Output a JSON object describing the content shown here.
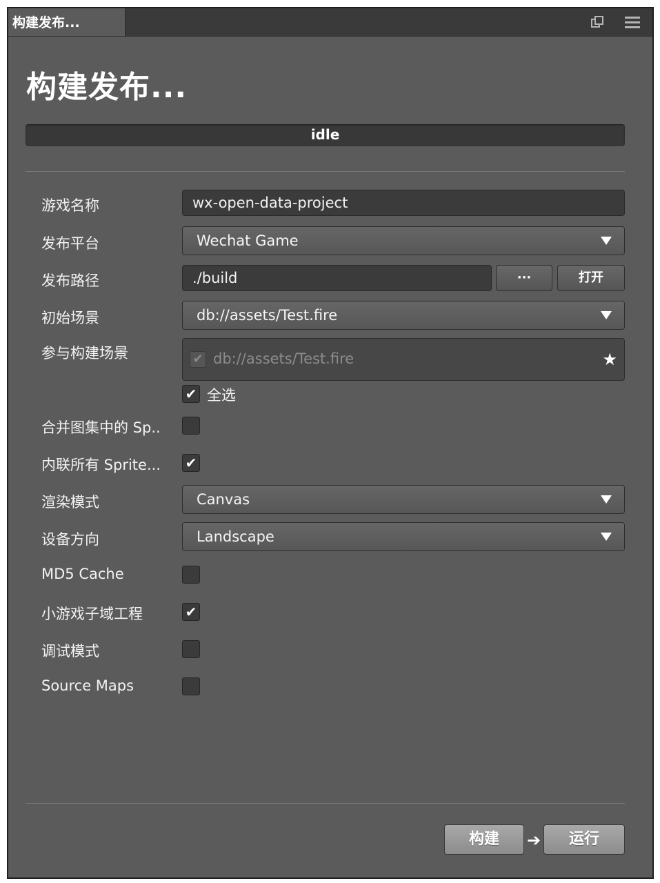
{
  "tab": {
    "title": "构建发布...",
    "popout_icon": "popout-window-icon",
    "menu_icon": "hamburger-menu-icon"
  },
  "page_title": "构建发布...",
  "status": "idle",
  "fields": {
    "game_name": {
      "label": "游戏名称",
      "value": "wx-open-data-project"
    },
    "platform": {
      "label": "发布平台",
      "value": "Wechat Game"
    },
    "build_path": {
      "label": "发布路径",
      "value": "./build",
      "browse_label": "···",
      "open_label": "打开"
    },
    "start_scene": {
      "label": "初始场景",
      "value": "db://assets/Test.fire"
    },
    "scenes": {
      "label": "参与构建场景",
      "items": [
        "db://assets/Test.fire"
      ],
      "select_all_label": "全选",
      "select_all_checked": true
    },
    "merge_sprites": {
      "label": "合并图集中的 Sp..",
      "checked": false
    },
    "inline_sprites": {
      "label": "内联所有 Sprite...",
      "checked": true
    },
    "render_mode": {
      "label": "渲染模式",
      "value": "Canvas"
    },
    "orientation": {
      "label": "设备方向",
      "value": "Landscape"
    },
    "md5_cache": {
      "label": "MD5 Cache",
      "checked": false
    },
    "subdomain": {
      "label": "小游戏子域工程",
      "checked": true
    },
    "debug": {
      "label": "调试模式",
      "checked": false
    },
    "source_maps": {
      "label": "Source Maps",
      "checked": false
    }
  },
  "actions": {
    "build_label": "构建",
    "run_label": "运行"
  },
  "colors": {
    "panel": "#5b5b5b",
    "field": "#3b3b3b",
    "tabbar": "#3a3a3a",
    "text": "#f2f2f2",
    "button": "#9a9a9a"
  }
}
